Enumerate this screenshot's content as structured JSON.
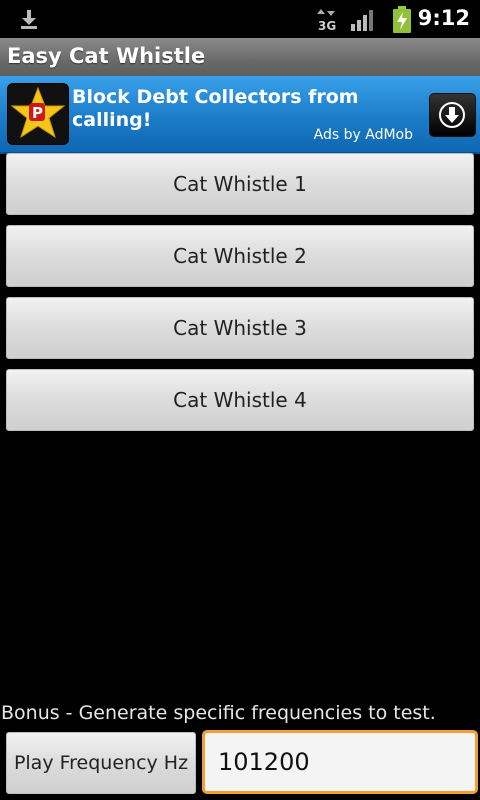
{
  "status_bar": {
    "time": "9:12",
    "network_label": "3G",
    "icons": [
      "download-icon",
      "network-3g-icon",
      "signal-icon",
      "battery-charging-icon"
    ]
  },
  "title_bar": {
    "title": "Easy Cat Whistle"
  },
  "ad": {
    "headline": "Block Debt Collectors from calling!",
    "attribution": "Ads by AdMob",
    "logo_icon": "app-logo-star-icon",
    "download_icon": "download-arrow-icon"
  },
  "whistles": {
    "items": [
      {
        "label": "Cat Whistle 1"
      },
      {
        "label": "Cat Whistle 2"
      },
      {
        "label": "Cat Whistle 3"
      },
      {
        "label": "Cat Whistle 4"
      }
    ]
  },
  "bonus": {
    "text": "Bonus - Generate specific frequencies to test.",
    "button_label": "Play Frequency Hz",
    "frequency_value": "101200"
  },
  "colors": {
    "ad_background": "#1c7cc8",
    "input_focus_border": "#f0a030",
    "background": "#000000"
  }
}
